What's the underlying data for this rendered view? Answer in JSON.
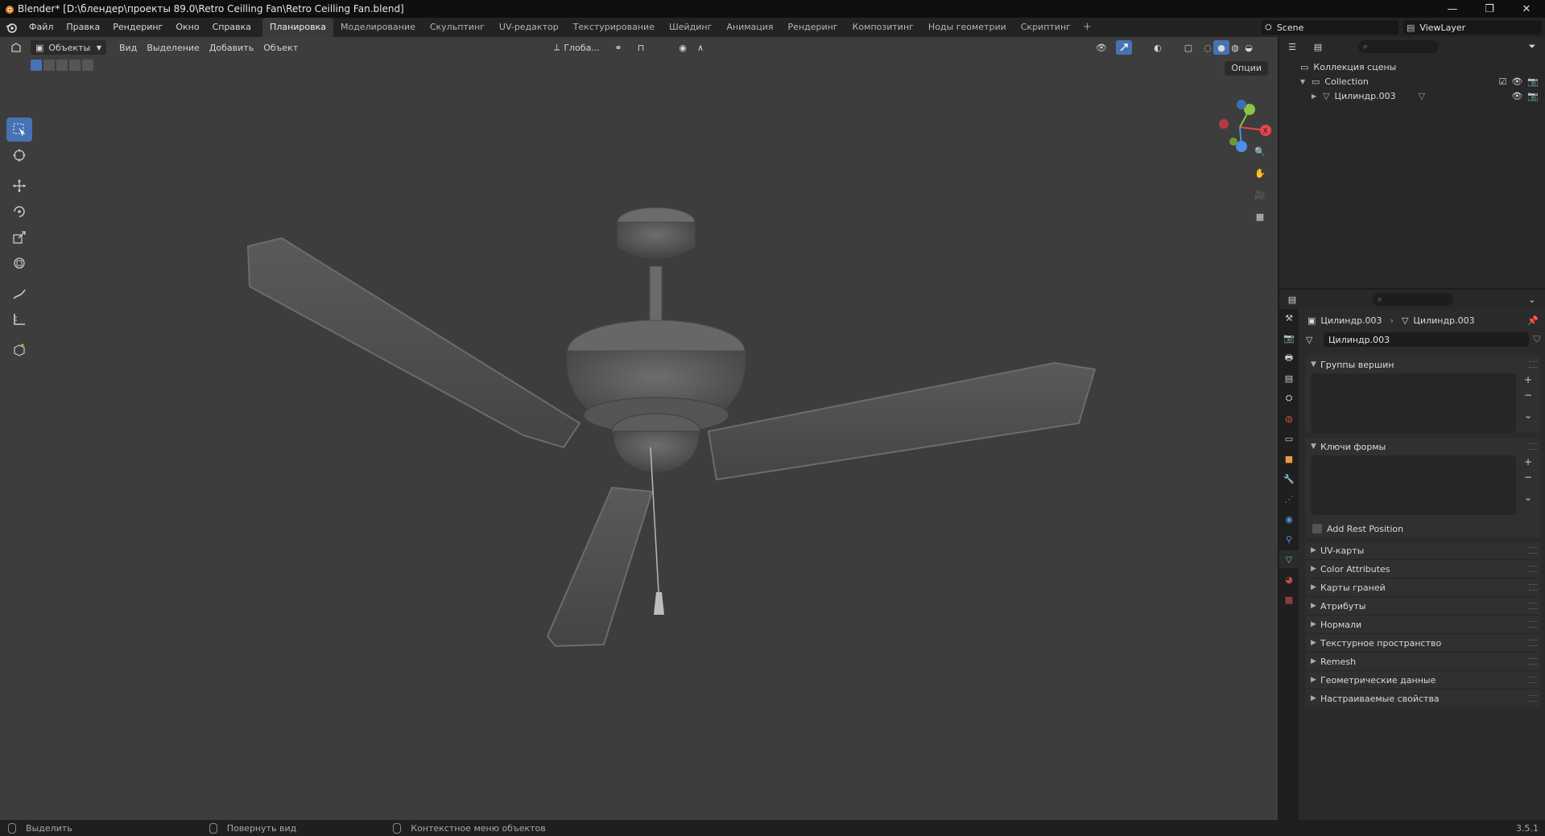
{
  "window": {
    "title": "Blender* [D:\\блендер\\проекты 89.0\\Retro Ceilling Fan\\Retro Ceilling Fan.blend]",
    "buttons": [
      "—",
      "❐",
      "✕"
    ]
  },
  "menu": {
    "items": [
      "Файл",
      "Правка",
      "Рендеринг",
      "Окно",
      "Справка"
    ],
    "workspaces": [
      "Планировка",
      "Моделирование",
      "Скульптинг",
      "UV-редактор",
      "Текстурирование",
      "Шейдинг",
      "Анимация",
      "Рендеринг",
      "Композитинг",
      "Ноды геометрии",
      "Скриптинг"
    ],
    "active_workspace": 0,
    "add_workspace": "+",
    "scene": "Scene",
    "view_layer": "ViewLayer"
  },
  "viewport": {
    "mode": "Объекты",
    "menus": [
      "Вид",
      "Выделение",
      "Добавить",
      "Объект"
    ],
    "transform_orientation": "Глоба...",
    "options": "Опции"
  },
  "gizmo": {
    "colors": {
      "x": "#e5464f",
      "y": "#8cc63f",
      "z": "#4d8fe6"
    },
    "labels": {
      "x": "X",
      "y": "Y",
      "z": "Z"
    }
  },
  "outliner": {
    "scene_collection": "Коллекция сцены",
    "collection": "Collection",
    "object": "Цилиндр.003"
  },
  "properties": {
    "breadcrumb_object": "Цилиндр.003",
    "breadcrumb_mesh": "Цилиндр.003",
    "mesh_name": "Цилиндр.003",
    "panels": {
      "vertex_groups": "Группы вершин",
      "shape_keys": "Ключи формы",
      "add_rest_position": "Add Rest Position"
    },
    "collapsed": [
      "UV-карты",
      "Color Attributes",
      "Карты граней",
      "Атрибуты",
      "Нормали",
      "Текстурное пространство",
      "Remesh",
      "Геометрические данные",
      "Настраиваемые свойства"
    ]
  },
  "status": {
    "select": "Выделить",
    "rotate": "Повернуть вид",
    "context_menu": "Контекстное меню объектов",
    "version": "3.5.1"
  }
}
